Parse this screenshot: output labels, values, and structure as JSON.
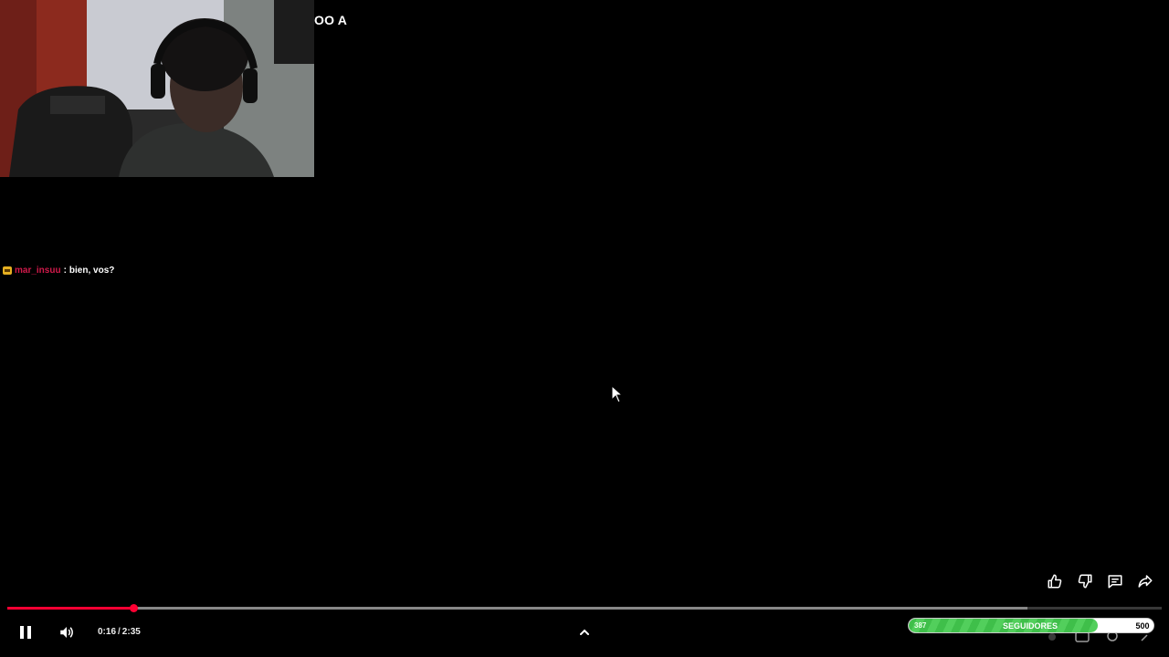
{
  "overlay": {
    "title_fragment": "OO A"
  },
  "chat": {
    "username": "mar_insuu",
    "separator": ":",
    "message": "bien, vos?"
  },
  "player": {
    "current_time": "0:16",
    "duration": "2:35",
    "time_separator": "/",
    "progress_fraction": 0.109,
    "buffered_fraction": 0.884,
    "accent_color": "#ff0033"
  },
  "actions": {
    "icons": [
      "thumbs-up-icon",
      "thumbs-down-icon",
      "comment-icon",
      "share-icon"
    ]
  },
  "controls": {
    "icons": [
      "pause-icon",
      "volume-icon",
      "chevron-up-icon"
    ]
  },
  "goal": {
    "current": "387",
    "label": "SEGUIDORES",
    "target": "500",
    "fill_fraction": 0.774,
    "fill_color": "#3fbf4a"
  }
}
